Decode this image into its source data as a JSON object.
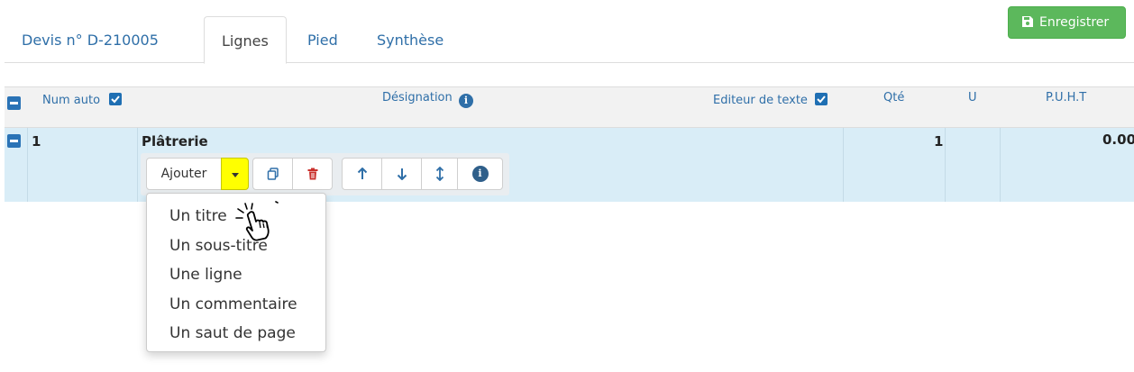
{
  "tabs": {
    "devis": "Devis n° D-210005",
    "lignes": "Lignes",
    "pied": "Pied",
    "synthese": "Synthèse"
  },
  "toolbar_top": {
    "save_label": "Enregistrer"
  },
  "table": {
    "headers": {
      "num_auto": "Num auto",
      "designation": "Désignation",
      "editeur": "Editeur de texte",
      "qte": "Qté",
      "u": "U",
      "puht": "P.U.H.T"
    },
    "row": {
      "num": "1",
      "designation": "Plâtrerie",
      "qte": "1",
      "u": "",
      "puht": "0.00"
    }
  },
  "row_toolbar": {
    "ajouter_label": "Ajouter"
  },
  "dropdown": {
    "items": [
      "Un titre",
      "Un sous-titre",
      "Une ligne",
      "Un commentaire",
      "Un saut de page"
    ]
  },
  "colors": {
    "link": "#2f6fa8",
    "save_green": "#5cb85c",
    "row_bg": "#d9edf7",
    "caret_yellow": "#ffff00",
    "trash_red": "#c9302c"
  },
  "icons": [
    "save-icon",
    "check-icon",
    "minus-icon",
    "info-icon",
    "caret-down-icon",
    "copy-icon",
    "trash-icon",
    "arrow-up-icon",
    "arrow-down-icon",
    "arrows-vertical-icon",
    "hand-pointer-icon"
  ]
}
